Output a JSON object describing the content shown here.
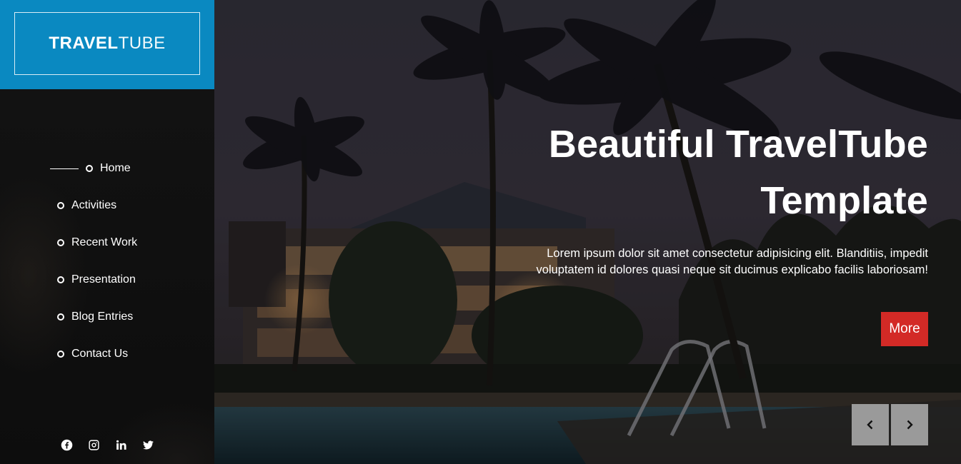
{
  "brand": {
    "bold": "TRAVEL",
    "light": "TUBE",
    "color": "#0a89c1"
  },
  "nav": {
    "items": [
      {
        "label": "Home",
        "active": true
      },
      {
        "label": "Activities"
      },
      {
        "label": "Recent Work"
      },
      {
        "label": "Presentation"
      },
      {
        "label": "Blog Entries"
      },
      {
        "label": "Contact Us"
      }
    ]
  },
  "social": [
    "facebook-icon",
    "instagram-icon",
    "linkedin-icon",
    "twitter-icon"
  ],
  "hero": {
    "title_line1": "Beautiful TravelTube",
    "title_line2": "Template",
    "text": "Lorem ipsum dolor sit amet consectetur adipisicing elit. Blanditiis, impedit voluptatem id dolores quasi neque sit ducimus explicabo facilis laboriosam!",
    "more_label": "More",
    "more_color": "#d32a26"
  },
  "slider": {
    "prev_icon": "chevron-left-icon",
    "next_icon": "chevron-right-icon"
  }
}
